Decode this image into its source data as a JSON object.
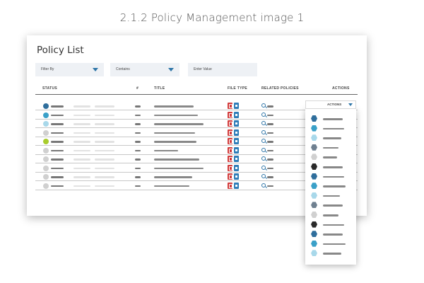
{
  "caption": "2.1.2 Policy Management image 1",
  "panel": {
    "title": "Policy List"
  },
  "filters": {
    "filter_by": "Filter By",
    "contains": "Contains",
    "enter_value": "Enter Value"
  },
  "table": {
    "headers": {
      "status": "STATUS",
      "number": "#",
      "title": "TITLE",
      "file_type": "FILE TYPE",
      "related_policies": "RELATED POLICIES",
      "actions": "ACTIONS"
    },
    "rows": [
      {
        "status_color": "#2f6e9c"
      },
      {
        "status_color": "#3aa0c8"
      },
      {
        "status_color": "#a8d8ea"
      },
      {
        "status_color": "#d0d0d0"
      },
      {
        "status_color": "#a8cc2c"
      },
      {
        "status_color": "#d0d0d0"
      },
      {
        "status_color": "#d0d0d0"
      },
      {
        "status_color": "#d0d0d0"
      },
      {
        "status_color": "#d0d0d0"
      },
      {
        "status_color": "#d0d0d0"
      }
    ],
    "file_icons": [
      "pdf-icon",
      "doc-icon"
    ],
    "related_icon": "search-icon"
  },
  "actions_button": {
    "label": "ACTIONS"
  },
  "actions_menu": {
    "item_colors": [
      "#2f6e9c",
      "#3aa0c8",
      "#a8d8ea",
      "#6f8090",
      "#d0d0d0",
      "#2a2a2a",
      "#2f6e9c",
      "#3aa0c8",
      "#a8d8ea",
      "#6f8090",
      "#d0d0d0",
      "#2a2a2a",
      "#2f6e9c",
      "#3aa0c8",
      "#a8d8ea"
    ]
  },
  "colors": {
    "accent": "#2f76a8",
    "pdf": "#d23b3b",
    "doc": "#2f7db8",
    "filter_bg": "#eef1f5"
  }
}
